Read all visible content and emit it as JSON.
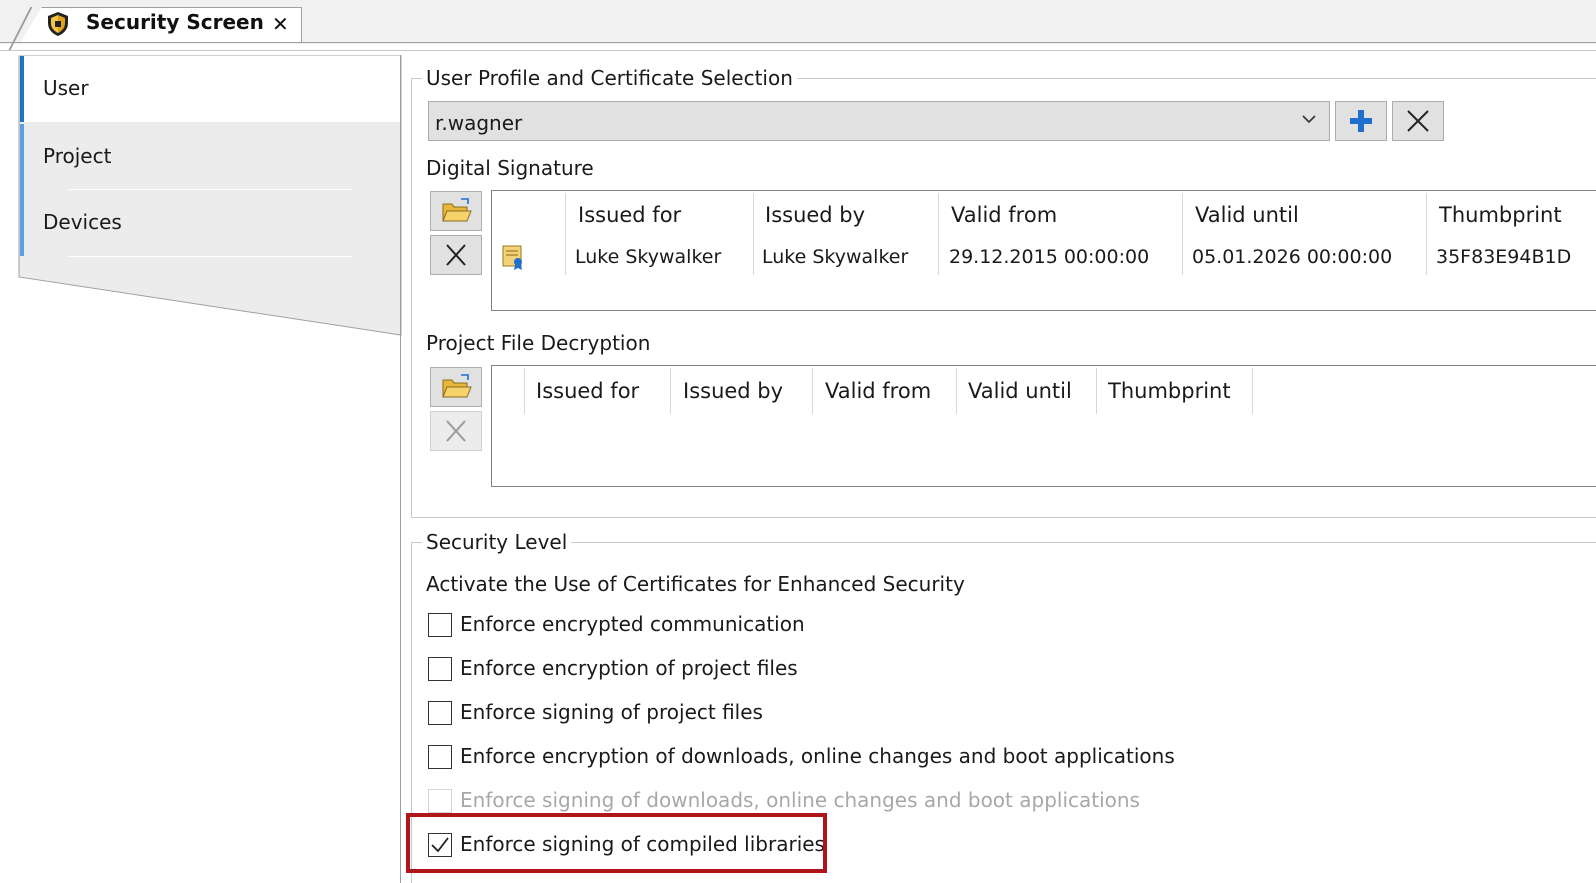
{
  "editor_tab": {
    "title": "Security Screen",
    "close_symbol": "✕",
    "icon": "shield-icon"
  },
  "nav": {
    "items": [
      {
        "label": "User",
        "selected": true
      },
      {
        "label": "Project",
        "selected": false
      },
      {
        "label": "Devices",
        "selected": false
      }
    ]
  },
  "profile_group": {
    "title": "User Profile and Certificate Selection",
    "selected_profile": "r.wagner",
    "add_button_icon": "plus-icon",
    "remove_button_icon": "close-icon"
  },
  "digital_signature": {
    "title": "Digital Signature",
    "columns": [
      "Issued for",
      "Issued by",
      "Valid from",
      "Valid until",
      "Thumbprint"
    ],
    "rows": [
      {
        "icon": "certificate-icon",
        "issued_for": "Luke Skywalker",
        "issued_by": "Luke Skywalker",
        "valid_from": "29.12.2015 00:00:00",
        "valid_until": "05.01.2026 00:00:00",
        "thumbprint": "35F83E94B1D"
      }
    ]
  },
  "project_file_decryption": {
    "title": "Project File Decryption",
    "columns": [
      "Issued for",
      "Issued by",
      "Valid from",
      "Valid until",
      "Thumbprint"
    ],
    "rows": []
  },
  "security_level": {
    "title": "Security Level",
    "subtitle": "Activate the Use of Certificates for Enhanced Security",
    "options": [
      {
        "label": "Enforce encrypted communication",
        "checked": false,
        "enabled": true
      },
      {
        "label": "Enforce encryption of project files",
        "checked": false,
        "enabled": true
      },
      {
        "label": "Enforce signing of project files",
        "checked": false,
        "enabled": true
      },
      {
        "label": "Enforce encryption of downloads, online changes and boot applications",
        "checked": false,
        "enabled": true
      },
      {
        "label": "Enforce signing of downloads, online changes and boot applications",
        "checked": false,
        "enabled": false
      },
      {
        "label": "Enforce signing of compiled libraries",
        "checked": true,
        "enabled": true,
        "highlighted": true
      }
    ]
  },
  "colors": {
    "nav_accent": "#1f72c4",
    "add_icon": "#1e6fd0",
    "highlight_border": "#b0151b",
    "folder_icon": "#f2c94c"
  }
}
